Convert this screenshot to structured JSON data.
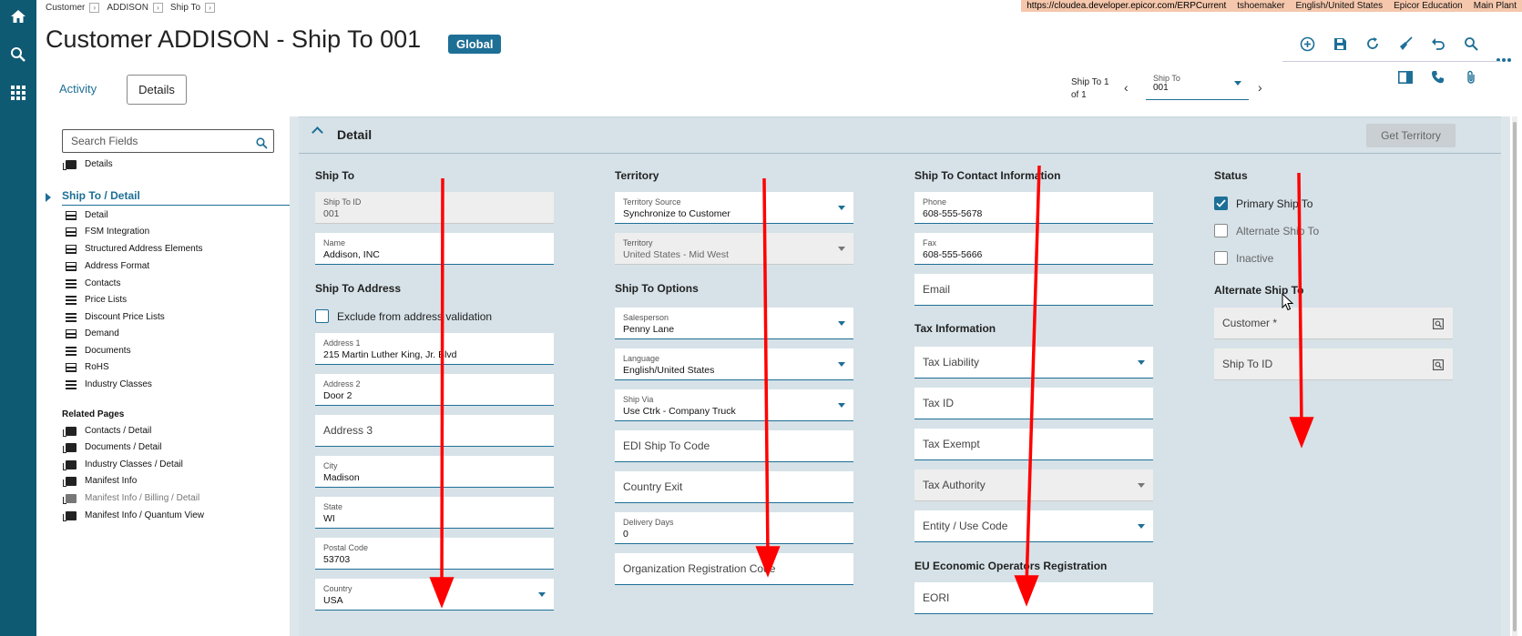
{
  "breadcrumb": [
    "Customer",
    "ADDISON",
    "Ship To"
  ],
  "env": {
    "url": "https://cloudea.developer.epicor.com/ERPCurrent",
    "user": "tshoemaker",
    "locale": "English/United States",
    "company": "Epicor Education",
    "plant": "Main Plant"
  },
  "page": {
    "title": "Customer ADDISON - Ship To 001",
    "badge": "Global"
  },
  "tabs": {
    "activity": "Activity",
    "details": "Details"
  },
  "record_nav": {
    "line1": "Ship To 1",
    "line2": "of 1",
    "select_label": "Ship To",
    "select_value": "001"
  },
  "sidebar": {
    "search_placeholder": "Search Fields",
    "top_item": "Details",
    "active": "Ship To / Detail",
    "items": [
      "Detail",
      "FSM Integration",
      "Structured Address Elements",
      "Address Format",
      "Contacts",
      "Price Lists",
      "Discount Price Lists",
      "Demand",
      "Documents",
      "RoHS",
      "Industry Classes"
    ],
    "related_title": "Related Pages",
    "related": [
      "Contacts / Detail",
      "Documents / Detail",
      "Industry Classes / Detail",
      "Manifest Info",
      "Manifest Info / Billing / Detail",
      "Manifest Info / Quantum View"
    ]
  },
  "detail": {
    "title": "Detail",
    "get_territory": "Get Territory",
    "ship_to": {
      "heading": "Ship To",
      "id_label": "Ship To ID",
      "id_value": "001",
      "name_label": "Name",
      "name_value": "Addison, INC"
    },
    "address": {
      "heading": "Ship To Address",
      "exclude": "Exclude from address validation",
      "address1_label": "Address 1",
      "address1_value": "215 Martin Luther King, Jr. Blvd",
      "address2_label": "Address 2",
      "address2_value": "Door 2",
      "address3_placeholder": "Address 3",
      "city_label": "City",
      "city_value": "Madison",
      "state_label": "State",
      "state_value": "WI",
      "postal_label": "Postal Code",
      "postal_value": "53703",
      "country_label": "Country",
      "country_value": "USA"
    },
    "territory": {
      "heading": "Territory",
      "source_label": "Territory Source",
      "source_value": "Synchronize to Customer",
      "territory_label": "Territory",
      "territory_value": "United States - Mid West"
    },
    "options": {
      "heading": "Ship To Options",
      "salesperson_label": "Salesperson",
      "salesperson_value": "Penny Lane",
      "language_label": "Language",
      "language_value": "English/United States",
      "shipvia_label": "Ship Via",
      "shipvia_value": "Use Ctrk - Company Truck",
      "edi_placeholder": "EDI Ship To Code",
      "country_exit_placeholder": "Country Exit",
      "delivery_label": "Delivery Days",
      "delivery_value": "0",
      "org_reg_placeholder": "Organization Registration Code"
    },
    "contact": {
      "heading": "Ship To Contact Information",
      "phone_label": "Phone",
      "phone_value": "608-555-5678",
      "fax_label": "Fax",
      "fax_value": "608-555-5666",
      "email_placeholder": "Email"
    },
    "tax": {
      "heading": "Tax Information",
      "liability": "Tax Liability",
      "tax_id": "Tax ID",
      "exempt": "Tax Exempt",
      "authority": "Tax Authority",
      "entity": "Entity / Use Code"
    },
    "eu": {
      "heading": "EU Economic Operators Registration",
      "eori": "EORI"
    },
    "status": {
      "heading": "Status",
      "primary": "Primary Ship To",
      "primary_checked": true,
      "alternate": "Alternate Ship To",
      "alternate_checked": false,
      "inactive": "Inactive",
      "inactive_checked": false
    },
    "alt_ship_to": {
      "heading": "Alternate Ship To",
      "customer": "Customer *",
      "ship_to_id": "Ship To ID"
    }
  },
  "colors": {
    "nav": "#0e5a73",
    "accent": "#1e6f96",
    "panel": "#d6e2e8",
    "annotation_arrow": "#ff0000",
    "env_bar": "#f5c7ac"
  }
}
